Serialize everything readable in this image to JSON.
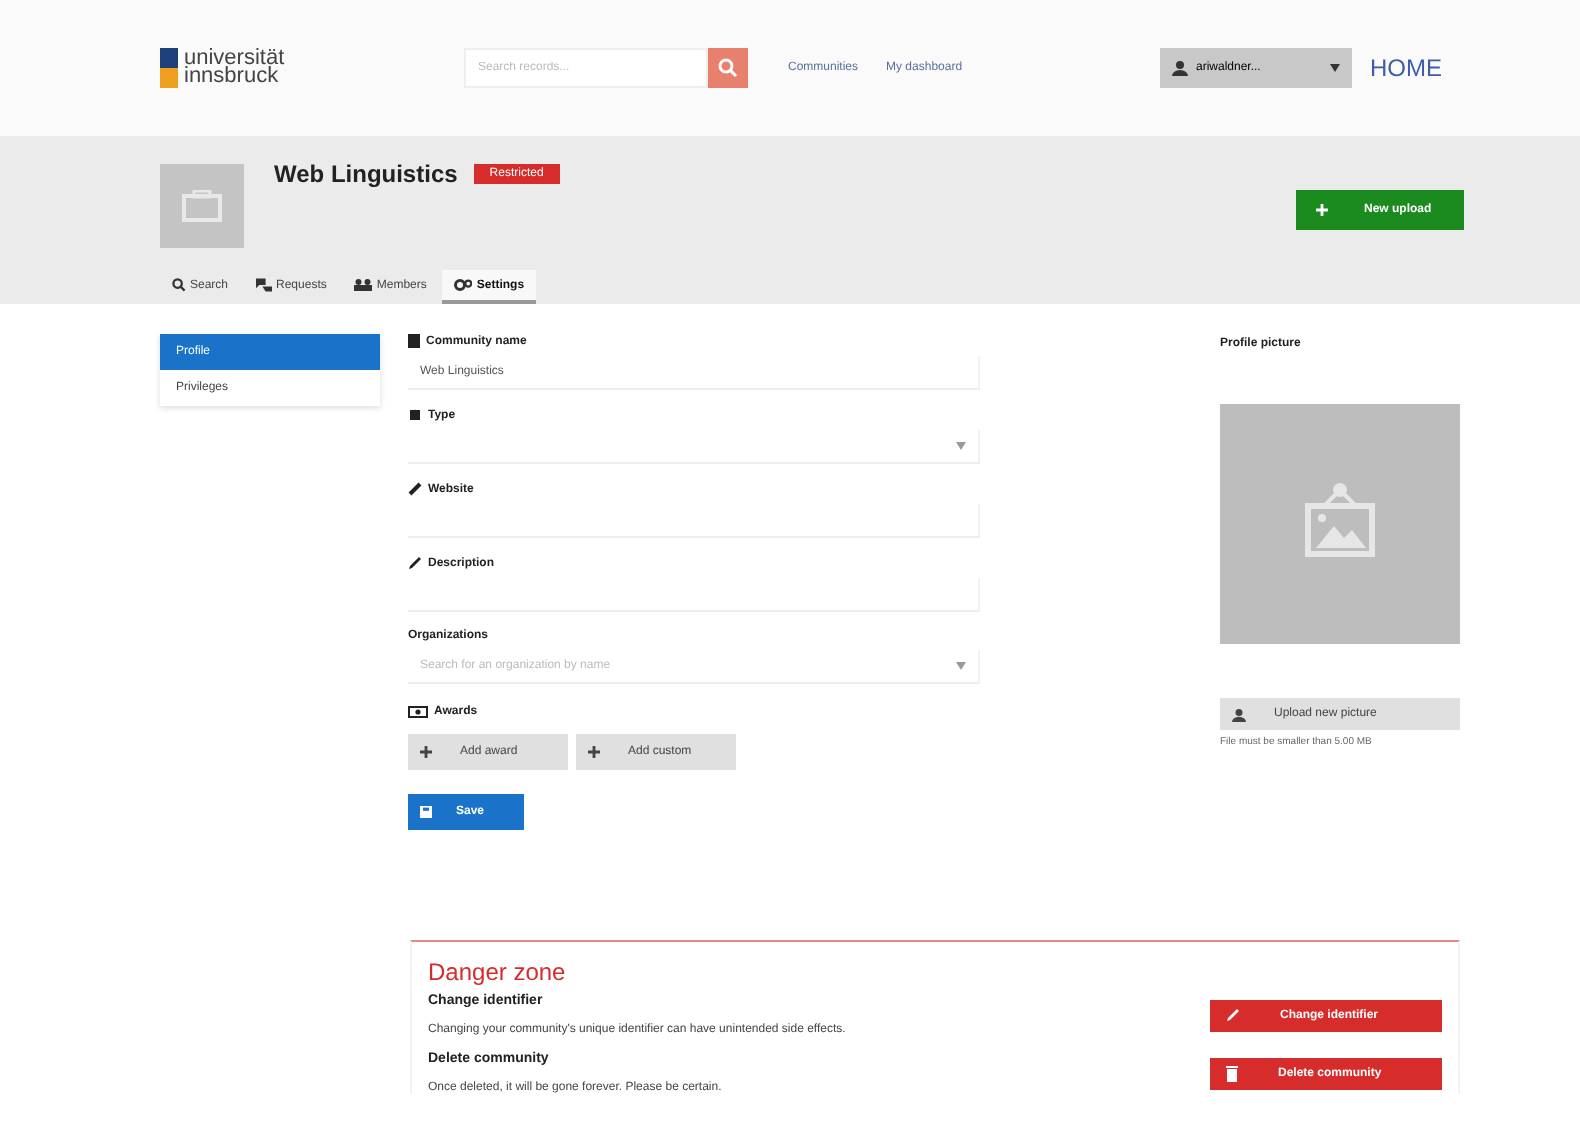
{
  "header": {
    "logo": {
      "line_1": "universität",
      "line_2": "innsbruck"
    },
    "search": {
      "placeholder": "Search records..."
    },
    "nav_links": [
      "Communities",
      "My dashboard"
    ],
    "user_menu": "ariwaldner...",
    "home_link": "HOME"
  },
  "community": {
    "title": "Web Linguistics",
    "badge": "Restricted",
    "new_upload": "New upload",
    "tabs": [
      {
        "label": "Search",
        "selected": false
      },
      {
        "label": "Requests",
        "selected": false
      },
      {
        "label": "Members",
        "selected": false
      },
      {
        "label": "Settings",
        "selected": true
      }
    ]
  },
  "sidebar": {
    "items": [
      {
        "label": "Profile",
        "selected": true
      },
      {
        "label": "Privileges",
        "selected": false
      }
    ]
  },
  "form": {
    "fields": [
      {
        "kind": "text",
        "label": "Community name",
        "value": "Web Linguistics"
      },
      {
        "kind": "select",
        "label": "Type"
      },
      {
        "kind": "text",
        "label": "Website"
      },
      {
        "kind": "text",
        "label": "Description"
      },
      {
        "kind": "select",
        "label": "Organizations",
        "placeholder": "Search for an organization by name"
      }
    ],
    "awards_label": "Awards",
    "award_buttons": [
      "Add award",
      "Add custom"
    ],
    "save": "Save"
  },
  "profile_picture": {
    "title": "Profile picture",
    "upload": "Upload new picture",
    "hint": "File must be smaller than 5.00 MB"
  },
  "danger_zone": {
    "title": "Danger zone",
    "items": [
      {
        "title": "Change identifier",
        "text": "Changing your community's unique identifier can have unintended side effects.",
        "button": "Change identifier"
      },
      {
        "title": "Delete community",
        "text": "Once deleted, it will be gone forever. Please be certain.",
        "button": "Delete community"
      }
    ]
  }
}
